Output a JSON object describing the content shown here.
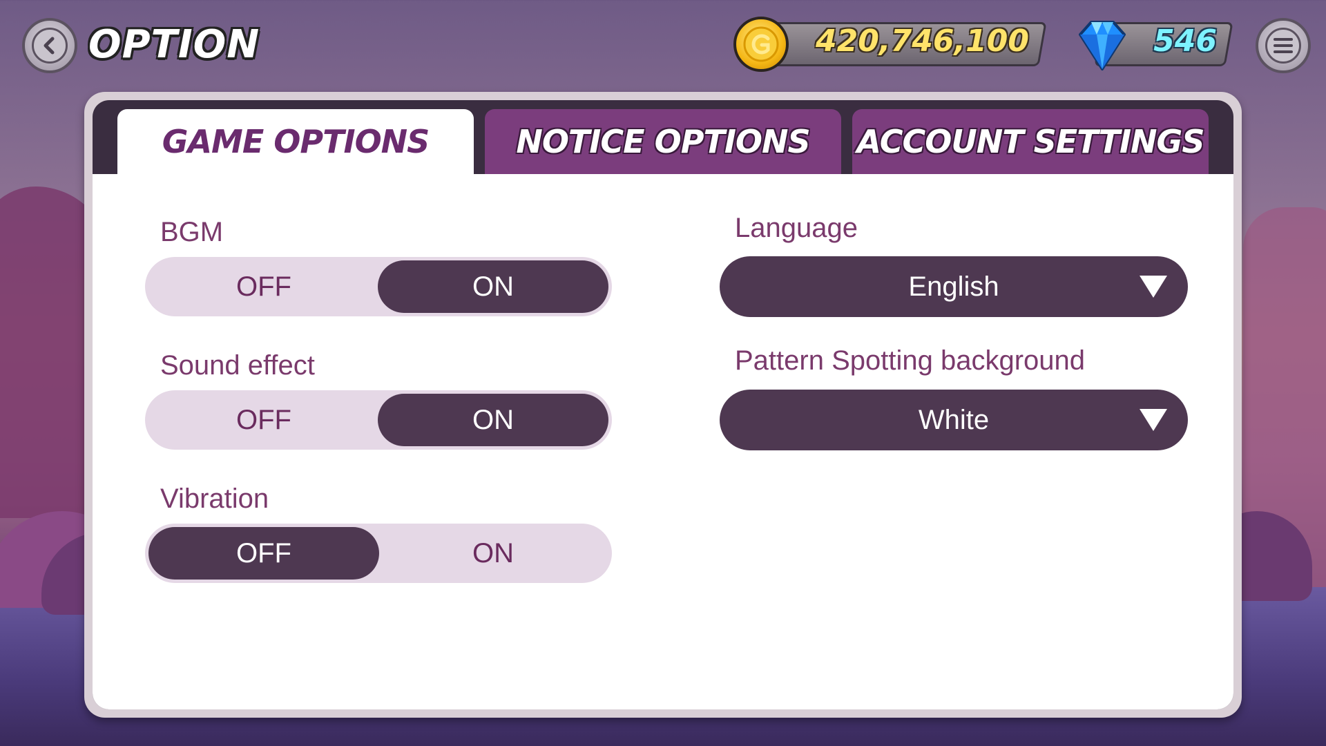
{
  "header": {
    "title": "OPTION",
    "gold": "420,746,100",
    "gems": "546"
  },
  "tabs": [
    {
      "label": "GAME OPTIONS",
      "active": true
    },
    {
      "label": "NOTICE OPTIONS",
      "active": false
    },
    {
      "label": "ACCOUNT SETTINGS",
      "active": false
    }
  ],
  "settings": {
    "bgm": {
      "label": "BGM",
      "off": "OFF",
      "on": "ON",
      "value": "ON"
    },
    "sound_effect": {
      "label": "Sound effect",
      "off": "OFF",
      "on": "ON",
      "value": "ON"
    },
    "vibration": {
      "label": "Vibration",
      "off": "OFF",
      "on": "ON",
      "value": "OFF"
    },
    "language": {
      "label": "Language",
      "value": "English"
    },
    "pattern_bg": {
      "label": "Pattern Spotting background",
      "value": "White"
    }
  },
  "colors": {
    "accent": "#7b3d7d",
    "selected": "#4e3851",
    "toggle_track": "#e5d8e6",
    "label": "#7a3a6c",
    "gold_text": "#ffe36a",
    "gem_text": "#7ef3ff"
  },
  "icons": {
    "back": "chevron-left-icon",
    "coin": "gold-coin-icon",
    "gem": "diamond-icon",
    "menu": "hamburger-menu-icon",
    "dropdown": "triangle-down-icon"
  }
}
